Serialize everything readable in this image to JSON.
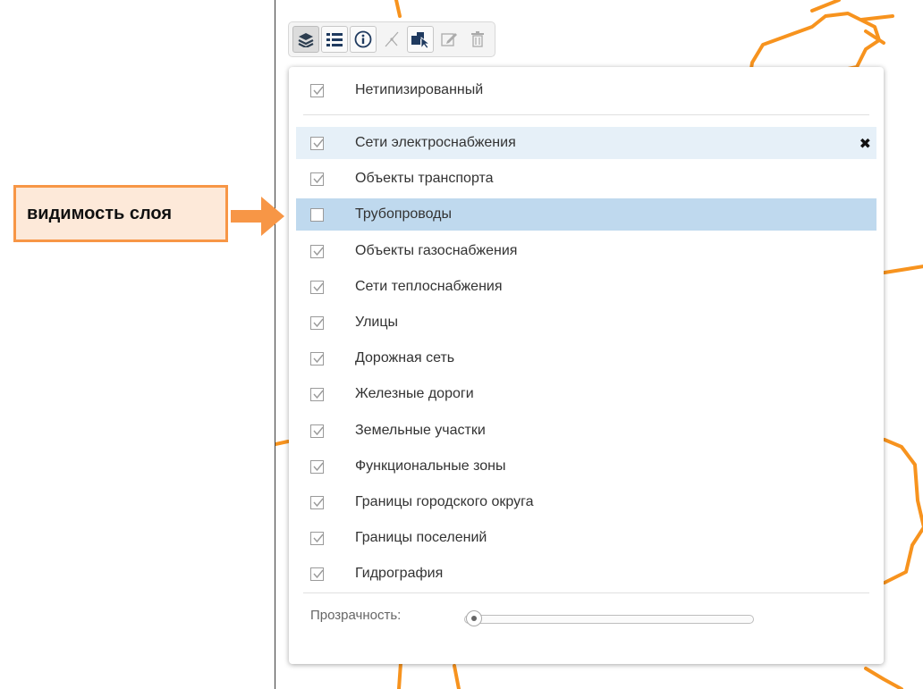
{
  "callout": {
    "text": "видимость слоя"
  },
  "toolbar": {
    "buttons": [
      {
        "icon": "layers-icon",
        "state": "active"
      },
      {
        "icon": "legend-list-icon",
        "state": "bordered"
      },
      {
        "icon": "info-icon",
        "state": "bordered"
      },
      {
        "icon": "measure-icon",
        "state": "disabled"
      },
      {
        "icon": "select-features-icon",
        "state": "bordered"
      },
      {
        "icon": "edit-icon",
        "state": "disabled"
      },
      {
        "icon": "trash-icon",
        "state": "disabled"
      }
    ]
  },
  "layers": {
    "untyped": {
      "label": "Нетипизированный",
      "checked": true
    },
    "items": [
      {
        "label": "Сети электроснабжения",
        "checked": true,
        "state": "hover"
      },
      {
        "label": "Объекты транспорта",
        "checked": true,
        "state": ""
      },
      {
        "label": "Трубопроводы",
        "checked": false,
        "state": "selected"
      },
      {
        "label": "Объекты газоснабжения",
        "checked": true,
        "state": ""
      },
      {
        "label": "Сети теплоснабжения",
        "checked": true,
        "state": ""
      },
      {
        "label": "Улицы",
        "checked": true,
        "state": ""
      },
      {
        "label": "Дорожная сеть",
        "checked": true,
        "state": ""
      },
      {
        "label": "Железные дороги",
        "checked": true,
        "state": ""
      },
      {
        "label": "Земельные участки",
        "checked": true,
        "state": ""
      },
      {
        "label": "Функциональные зоны",
        "checked": true,
        "state": ""
      },
      {
        "label": "Границы городского округа",
        "checked": true,
        "state": ""
      },
      {
        "label": "Границы поселений",
        "checked": true,
        "state": ""
      },
      {
        "label": "Гидрография",
        "checked": true,
        "state": ""
      }
    ],
    "remove_symbol": "✖"
  },
  "opacity": {
    "label": "Прозрачность:",
    "value": 0
  },
  "colors": {
    "accent": "#f79646",
    "callout_bg": "#fde9d9",
    "map_line": "#f7931e",
    "hover_row": "#e6f0f8",
    "selected_row": "#bfd9ee"
  }
}
